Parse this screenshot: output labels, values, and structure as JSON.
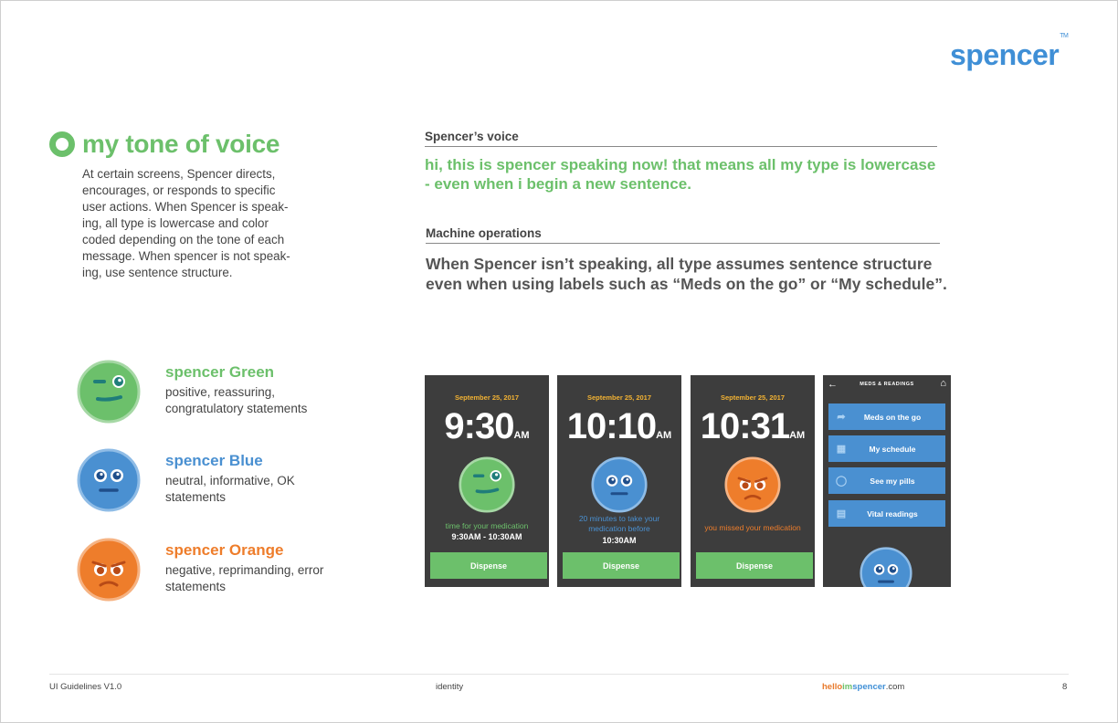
{
  "brand": {
    "logo": "spencer",
    "tm": "TM"
  },
  "section": {
    "title": "my tone of voice",
    "intro": "At certain screens, Spencer directs, encourages, or responds to specific user actions. When Spencer is speak-ing, all type is lowercase and color coded depending on the tone of each message. When spencer is not speak-ing, use sentence structure."
  },
  "tones": [
    {
      "name": "spencer Green",
      "color": "#6cc06b",
      "description": "positive, reassuring, congratulatory statements",
      "icon": "winking-face-icon"
    },
    {
      "name": "spencer Blue",
      "color": "#4a90d1",
      "description": "neutral, informative, OK statements",
      "icon": "neutral-face-icon"
    },
    {
      "name": "spencer Orange",
      "color": "#ee7d2b",
      "description": "negative, reprimanding, error statements",
      "icon": "worried-face-icon"
    }
  ],
  "voice": {
    "label": "Spencer’s voice",
    "text": "hi, this is spencer speaking now! that means all my type is lowercase - even when i begin a new sentence."
  },
  "machine": {
    "label": "Machine operations",
    "text": "When Spencer isn’t speaking, all type assumes sentence structure even when using labels such as “Meds on the go” or “My schedule”."
  },
  "phones": [
    {
      "date": "September 25, 2017",
      "time": "9:30",
      "ampm": "AM",
      "message": "time for your medication",
      "message_color": "#6cc06b",
      "detail": "9:30AM - 10:30AM",
      "button": "Dispense"
    },
    {
      "date": "September 25, 2017",
      "time": "10:10",
      "ampm": "AM",
      "message": "20 minutes to take your medication before",
      "message_color": "#4a90d1",
      "detail": "10:30AM",
      "button": "Dispense"
    },
    {
      "date": "September 25, 2017",
      "time": "10:31",
      "ampm": "AM",
      "message": "you missed your medication",
      "message_color": "#ee7d2b",
      "detail": "",
      "button": "Dispense"
    }
  ],
  "menu_phone": {
    "title": "MEDS & READINGS",
    "items": [
      {
        "label": "Meds on the go",
        "icon": "share-arrow-icon"
      },
      {
        "label": "My schedule",
        "icon": "calendar-icon"
      },
      {
        "label": "See my pills",
        "icon": "pill-icon"
      },
      {
        "label": "Vital readings",
        "icon": "book-icon"
      }
    ]
  },
  "footer": {
    "left": "UI Guidelines V1.0",
    "center": "identity",
    "url_hello": "hello",
    "url_im": "im",
    "url_spencer": "spencer",
    "url_tld": ".com",
    "page": "8"
  }
}
